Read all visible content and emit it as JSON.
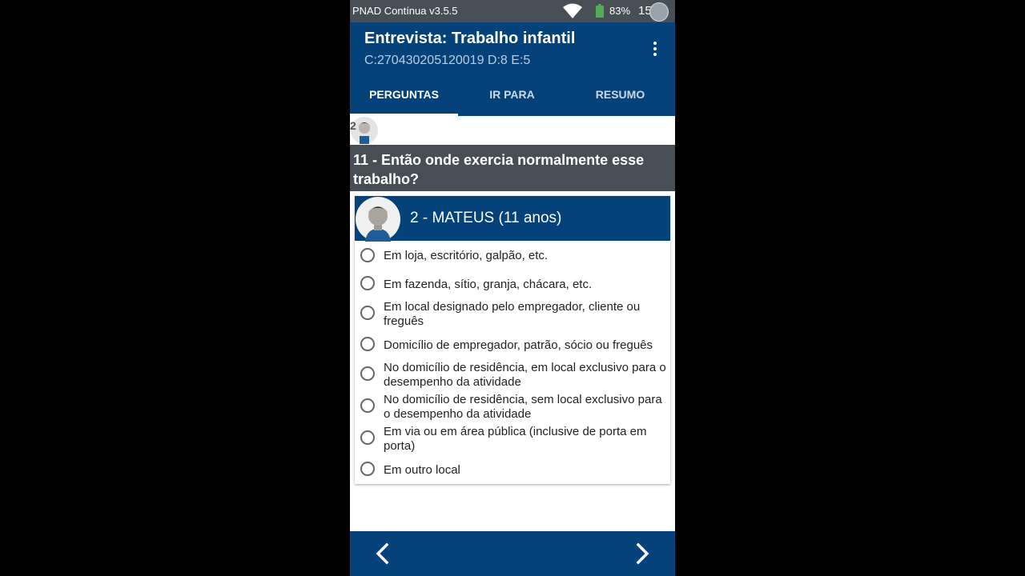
{
  "status_bar": {
    "app_name": "PNAD Contínua v3.5.5",
    "battery": "83%",
    "time": "15:5",
    "icons": [
      "wifi-icon",
      "battery-icon",
      "screen-record-icon"
    ]
  },
  "app_bar": {
    "title": "Entrevista: Trabalho infantil",
    "subtitle": "C:270430205120019 D:8 E:5",
    "menu_icon": "more-vert-icon"
  },
  "tabs": [
    {
      "label": "PERGUNTAS",
      "active": true
    },
    {
      "label": "IR PARA",
      "active": false
    },
    {
      "label": "RESUMO",
      "active": false
    }
  ],
  "mini_row": {
    "number": "2"
  },
  "question": {
    "text": "11 - Então onde exercia normalmente esse trabalho?"
  },
  "person": {
    "name": "2 - MATEUS (11 anos)"
  },
  "options": [
    {
      "label": "Em loja, escritório, galpão, etc.",
      "selected": false
    },
    {
      "label": "Em fazenda, sítio, granja, chácara, etc.",
      "selected": false
    },
    {
      "label": "Em local designado pelo empregador, cliente ou freguês",
      "selected": false
    },
    {
      "label": "Domicílio de empregador, patrão, sócio ou freguês",
      "selected": false
    },
    {
      "label": "No domicílio de residência, em local exclusivo para o desempenho da atividade",
      "selected": false
    },
    {
      "label": "No domicílio de residência, sem local exclusivo para o desempenho da atividade",
      "selected": false
    },
    {
      "label": "Em via ou em área pública (inclusive de porta em porta)",
      "selected": false
    },
    {
      "label": "Em outro local",
      "selected": false
    }
  ],
  "navigation": {
    "prev_icon": "chevron-left-icon",
    "next_icon": "chevron-right-icon"
  },
  "colors": {
    "primary": "#05427a",
    "status_bar": "#474e55",
    "question_bar": "#474e55",
    "background": "#000000"
  }
}
